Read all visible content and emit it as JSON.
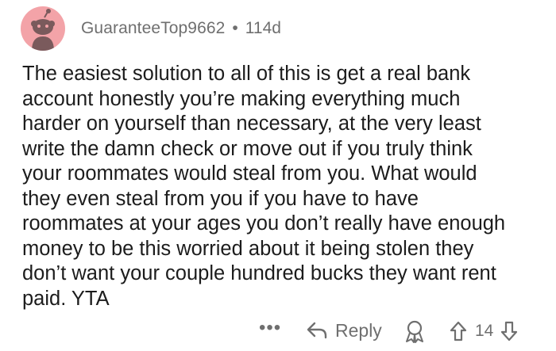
{
  "comment": {
    "username": "GuaranteeTop9662",
    "separator": "•",
    "age": "114d",
    "lines": [
      "The easiest solution to all of this is get a real bank",
      "account honestly you’re making everything much",
      "harder on yourself than necessary, at the very least",
      "write the damn check or move out if you truly think",
      "your roommates would steal from you. What would",
      "they even steal from you if you have to have",
      "roommates at your ages you don’t really have enough",
      "money to be this worried about it being stolen they",
      "don’t want your couple hundred bucks they want rent",
      "paid. YTA"
    ]
  },
  "actions": {
    "more": "•••",
    "reply_label": "Reply",
    "vote_count": "14"
  },
  "icons": {
    "avatar": "snoo-avatar-icon",
    "reply": "reply-arrow-icon",
    "award": "award-icon",
    "upvote": "upvote-arrow-icon",
    "downvote": "downvote-arrow-icon"
  },
  "colors": {
    "avatar_bg": "#f3a3a8",
    "meta_text": "#6f6f6f",
    "body_text": "#1c1c1c"
  }
}
